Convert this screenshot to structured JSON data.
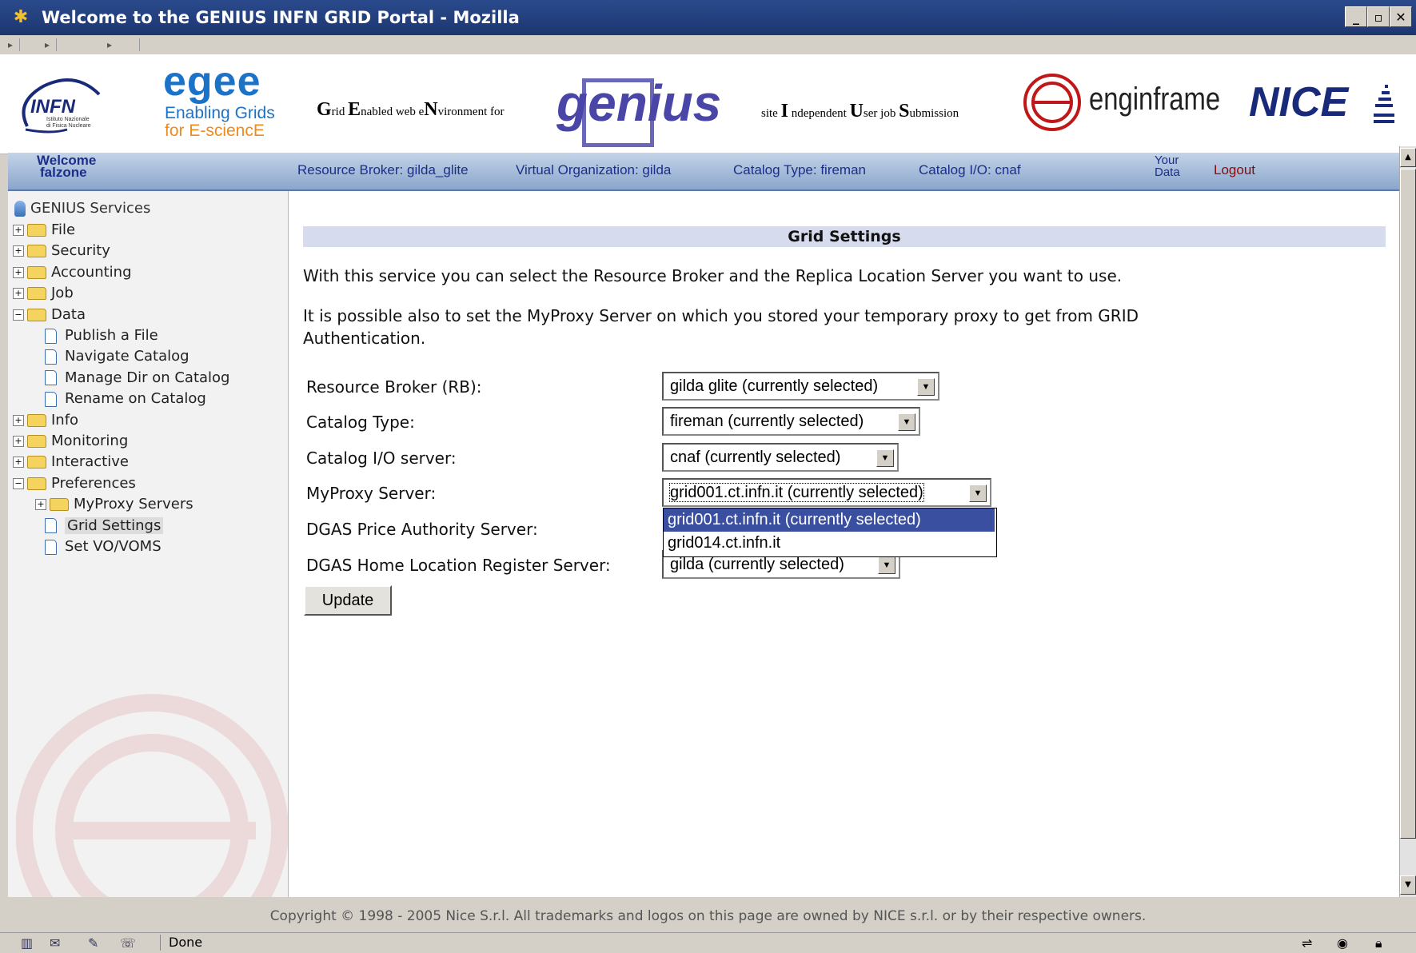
{
  "window": {
    "title": "Welcome to the GENIUS INFN GRID Portal - Mozilla",
    "buttons": {
      "minimize": "_",
      "maximize": "▫",
      "close": "✕"
    }
  },
  "banner": {
    "infn": {
      "name": "INFN",
      "sub1": "Istituto Nazionale",
      "sub2": "di Fisica Nucleare"
    },
    "egee": {
      "name": "egee",
      "line1": "Enabling Grids",
      "line2": "for E-sciencE"
    },
    "genius_left": {
      "g": "G",
      "rid": "rid ",
      "e": "E",
      "nabled": "nabled web e",
      "n": "N",
      "vironment": "vironment for"
    },
    "genius_logo": "genius",
    "genius_right": {
      "site": "site ",
      "i": "I",
      "ndependent": " ndependent ",
      "u": "U",
      "ser": "ser job ",
      "s": "S",
      "ubmission": "ubmission"
    },
    "enginframe": "enginframe",
    "nice": "NICE"
  },
  "navbar": {
    "welcome": "Welcome",
    "user": "falzone",
    "resource_broker": "Resource Broker: gilda_glite",
    "virtual_org": "Virtual Organization: gilda",
    "catalog_type": "Catalog Type: fireman",
    "catalog_io": "Catalog I/O: cnaf",
    "your": "Your",
    "data": "Data",
    "logout": "Logout"
  },
  "sidebar": {
    "root": "GENIUS Services",
    "items": [
      {
        "label": "File",
        "kind": "folder",
        "state": "+"
      },
      {
        "label": "Security",
        "kind": "folder",
        "state": "+"
      },
      {
        "label": "Accounting",
        "kind": "folder",
        "state": "+"
      },
      {
        "label": "Job",
        "kind": "folder",
        "state": "+"
      },
      {
        "label": "Data",
        "kind": "folder",
        "state": "−"
      },
      {
        "label": "Publish a File",
        "kind": "doc"
      },
      {
        "label": "Navigate Catalog",
        "kind": "doc"
      },
      {
        "label": "Manage Dir on Catalog",
        "kind": "doc"
      },
      {
        "label": "Rename on Catalog",
        "kind": "doc"
      },
      {
        "label": "Info",
        "kind": "folder",
        "state": "+"
      },
      {
        "label": "Monitoring",
        "kind": "folder",
        "state": "+"
      },
      {
        "label": "Interactive",
        "kind": "folder",
        "state": "+"
      },
      {
        "label": "Preferences",
        "kind": "folder",
        "state": "−"
      },
      {
        "label": "MyProxy Servers",
        "kind": "folder",
        "state": "+"
      },
      {
        "label": "Grid Settings",
        "kind": "doc",
        "selected": true
      },
      {
        "label": "Set VO/VOMS",
        "kind": "doc"
      }
    ]
  },
  "main": {
    "title": "Grid Settings",
    "intro1": "With this service you can select the Resource Broker and the Replica Location Server you want to use.",
    "intro2a": "It is possible also to set the MyProxy Server on which you stored your temporary proxy to get from GRID",
    "intro2b": "Authentication.",
    "fields": {
      "rb": {
        "label": "Resource Broker (RB):",
        "value": "gilda glite (currently selected)"
      },
      "catalog_type": {
        "label": "Catalog Type:",
        "value": "fireman (currently selected)"
      },
      "catalog_io": {
        "label": "Catalog I/O server:",
        "value": "cnaf (currently selected)"
      },
      "myproxy": {
        "label": "MyProxy Server:",
        "value": "grid001.ct.infn.it (currently selected)"
      },
      "dgas_price": {
        "label": "DGAS Price Authority Server:"
      },
      "dgas_hlr": {
        "label": "DGAS Home Location Register Server:",
        "value": "gilda (currently selected)"
      }
    },
    "myproxy_options": [
      "grid001.ct.infn.it (currently selected)",
      "grid014.ct.infn.it"
    ],
    "update_button": "Update"
  },
  "footer": {
    "copyright": "Copyright © 1998 - 2005 Nice S.r.l. All trademarks and logos on this page are owned by NICE s.r.l. or by their respective owners."
  },
  "statusbar": {
    "status": "Done"
  },
  "colors": {
    "nav_text": "#1b2f8a",
    "logout": "#8a0a0a",
    "highlight": "#3a4f9f",
    "egee_orange": "#f08a1c",
    "egee_blue": "#1a73c8",
    "genius_blue": "#4a46a8"
  }
}
